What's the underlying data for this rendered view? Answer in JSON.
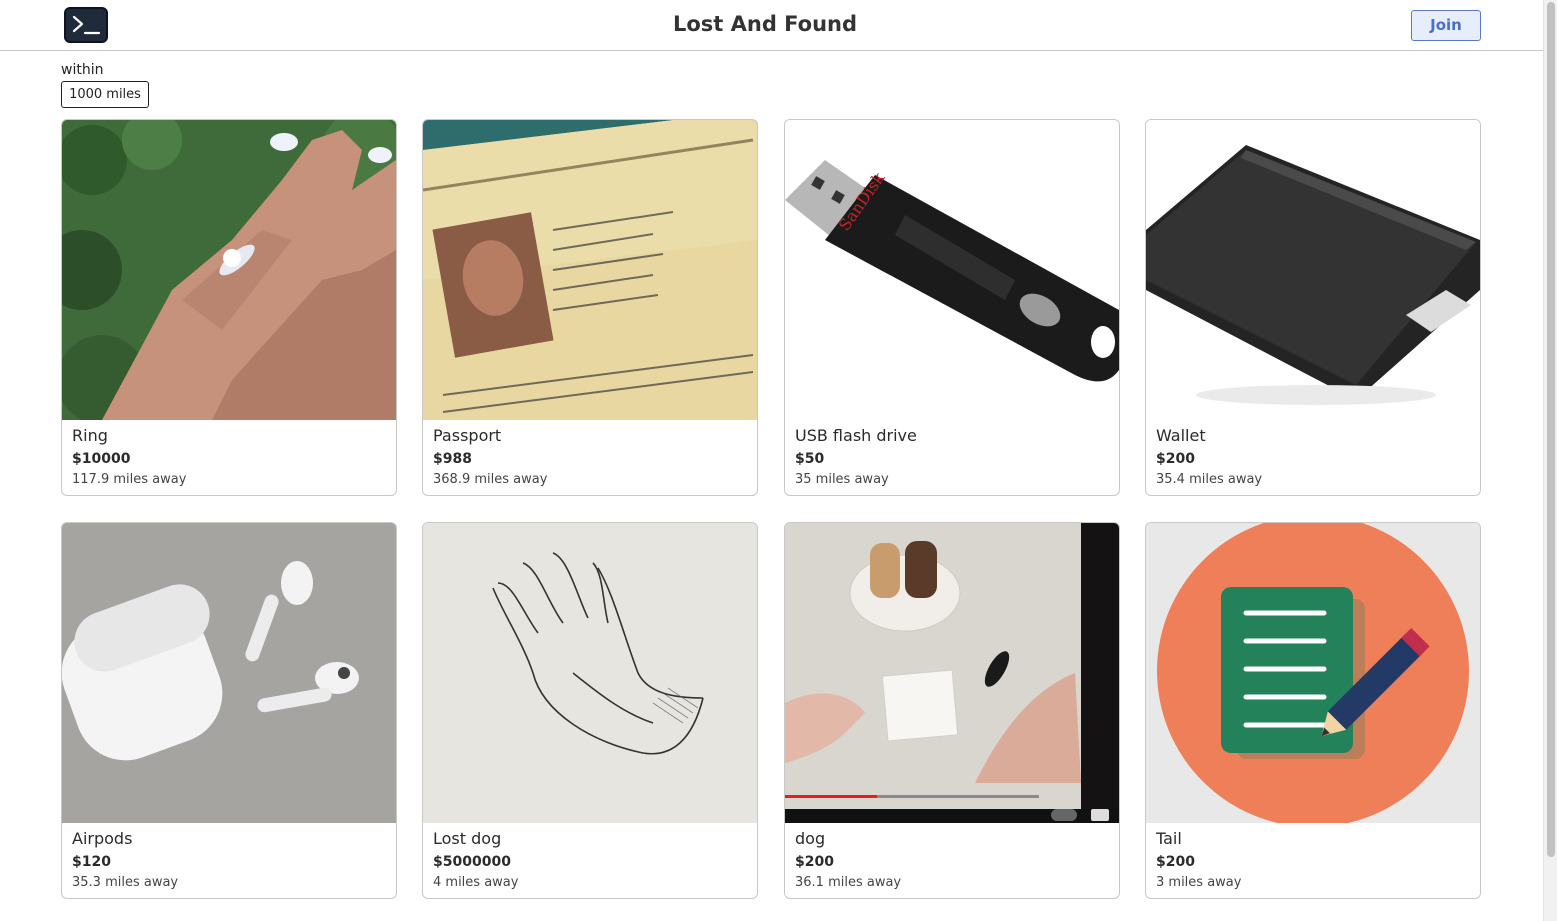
{
  "header": {
    "title": "Lost And Found",
    "join_label": "Join",
    "logo_icon": "terminal-icon"
  },
  "filter": {
    "label": "within",
    "value": "1000 miles"
  },
  "items": [
    {
      "name": "Ring",
      "price": "$10000",
      "distance": "117.9 miles away",
      "image": "ring-on-hand-photo"
    },
    {
      "name": "Passport",
      "price": "$988",
      "distance": "368.9 miles away",
      "image": "passport-photo"
    },
    {
      "name": "USB flash drive",
      "price": "$50",
      "distance": "35 miles away",
      "image": "usb-drive-photo"
    },
    {
      "name": "Wallet",
      "price": "$200",
      "distance": "35.4 miles away",
      "image": "wallet-photo"
    },
    {
      "name": "Airpods",
      "price": "$120",
      "distance": "35.3 miles away",
      "image": "airpods-photo"
    },
    {
      "name": "Lost dog",
      "price": "$5000000",
      "distance": "4 miles away",
      "image": "hand-sketch-photo"
    },
    {
      "name": "dog",
      "price": "$200",
      "distance": "36.1 miles away",
      "image": "video-still-photo"
    },
    {
      "name": "Tail",
      "price": "$200",
      "distance": "3 miles away",
      "image": "notepad-pencil-illustration"
    }
  ],
  "colors": {
    "accent": "#4a6fc4",
    "accent_bg": "#e7edfa",
    "logo_bg": "#1f2a3a",
    "border": "#c8c8c8"
  }
}
